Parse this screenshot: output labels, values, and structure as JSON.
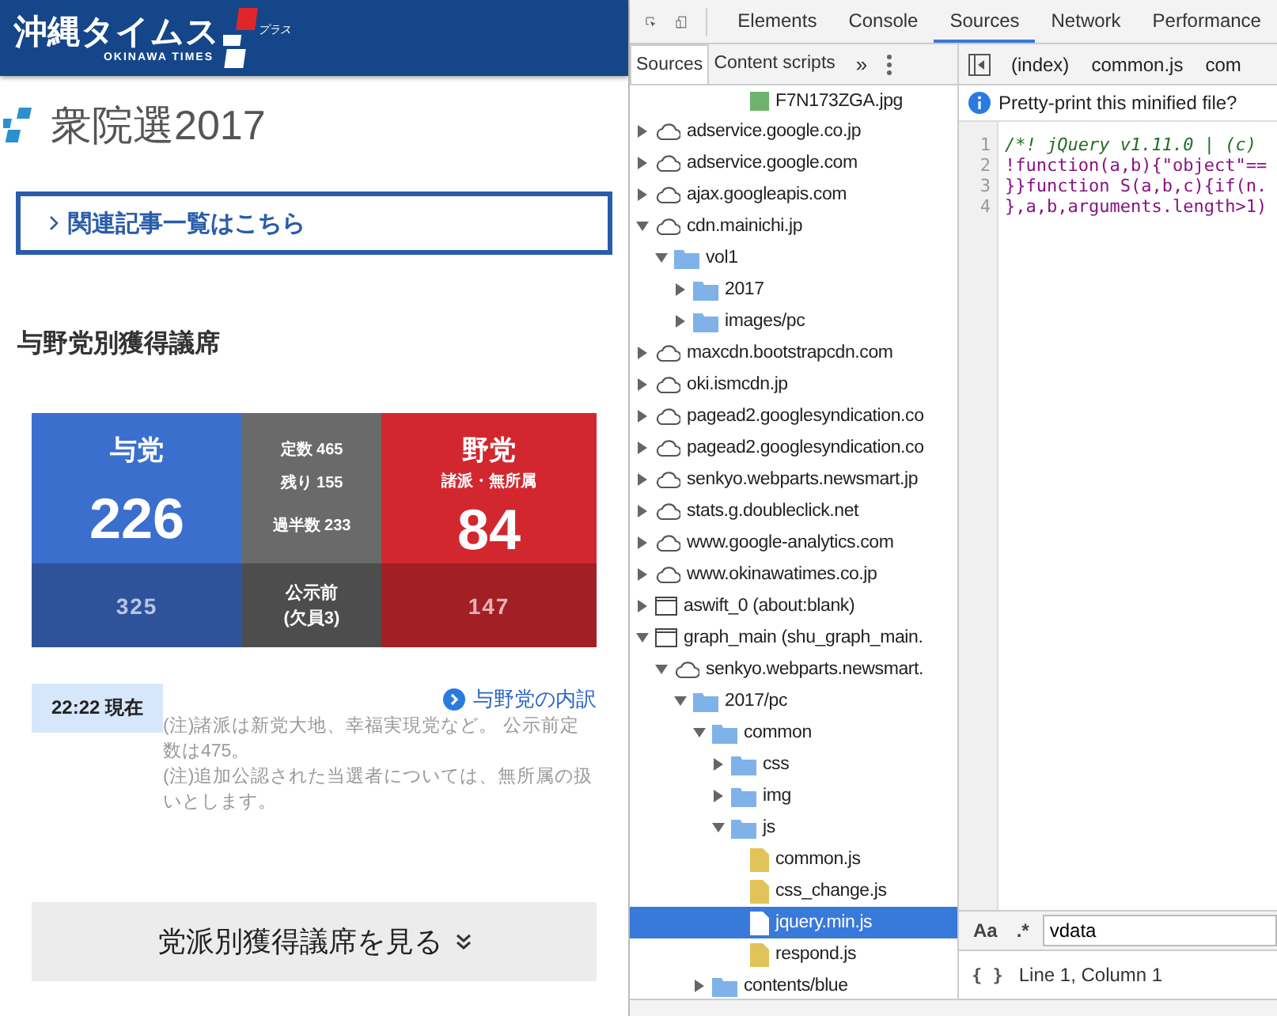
{
  "page": {
    "logo": {
      "name": "沖縄タイムス",
      "plus": "プラス",
      "romaji": "OKINAWA TIMES"
    },
    "title": "衆院選2017",
    "related_link": "関連記事一覧はこちら",
    "section_heading": "与野党別獲得議席",
    "scoreboard": {
      "columns": [
        {
          "kind": "ruling",
          "name": "与党",
          "seats": "226",
          "before": "325"
        },
        {
          "kind": "center",
          "lines": [
            "定数 465",
            "残り 155",
            "過半数 233"
          ],
          "before_lines": [
            "公示前",
            "(欠員3)"
          ]
        },
        {
          "kind": "opposition",
          "name": "野党",
          "sub": "諸派・無所属",
          "seats": "84",
          "before": "147"
        }
      ]
    },
    "timestamp": "22:22 現在",
    "breakdown_link": "与野党の内訳",
    "notes": [
      "(注)諸派は新党大地、幸福実現党など。 公示前定数は475。",
      "(注)追加公認された当選者については、無所属の扱いとします。"
    ],
    "more_button": "党派別獲得議席を見る"
  },
  "devtools": {
    "main_tabs": [
      {
        "label": "Elements",
        "selected": false
      },
      {
        "label": "Console",
        "selected": false
      },
      {
        "label": "Sources",
        "selected": true
      },
      {
        "label": "Network",
        "selected": false
      },
      {
        "label": "Performance",
        "selected": false
      }
    ],
    "navigator_tabs": [
      {
        "label": "Sources",
        "selected": true
      },
      {
        "label": "Content scripts",
        "selected": false
      }
    ],
    "more_tabs": "»",
    "partial_top_item": {
      "kind": "image",
      "name": "F7N173ZGA.jpg"
    },
    "tree": [
      {
        "kind": "domain",
        "name": "adservice.google.co.jp",
        "expanded": false
      },
      {
        "kind": "domain",
        "name": "adservice.google.com",
        "expanded": false
      },
      {
        "kind": "domain",
        "name": "ajax.googleapis.com",
        "expanded": false
      },
      {
        "kind": "domain",
        "name": "cdn.mainichi.jp",
        "expanded": true,
        "children": [
          {
            "kind": "folder",
            "name": "vol1",
            "expanded": true,
            "children": [
              {
                "kind": "folder",
                "name": "2017",
                "expanded": false
              },
              {
                "kind": "folder",
                "name": "images/pc",
                "expanded": false
              }
            ]
          }
        ]
      },
      {
        "kind": "domain",
        "name": "maxcdn.bootstrapcdn.com",
        "expanded": false
      },
      {
        "kind": "domain",
        "name": "oki.ismcdn.jp",
        "expanded": false
      },
      {
        "kind": "domain",
        "name": "pagead2.googlesyndication.co",
        "expanded": false
      },
      {
        "kind": "domain",
        "name": "pagead2.googlesyndication.co",
        "expanded": false
      },
      {
        "kind": "domain",
        "name": "senkyo.webparts.newsmart.jp",
        "expanded": false
      },
      {
        "kind": "domain",
        "name": "stats.g.doubleclick.net",
        "expanded": false
      },
      {
        "kind": "domain",
        "name": "www.google-analytics.com",
        "expanded": false
      },
      {
        "kind": "domain",
        "name": "www.okinawatimes.co.jp",
        "expanded": false
      },
      {
        "kind": "frame",
        "name": "aswift_0 (about:blank)",
        "expanded": false
      },
      {
        "kind": "frame",
        "name": "graph_main (shu_graph_main.",
        "expanded": true,
        "children": [
          {
            "kind": "domain",
            "name": "senkyo.webparts.newsmart.",
            "expanded": true,
            "children": [
              {
                "kind": "folder",
                "name": "2017/pc",
                "expanded": true,
                "children": [
                  {
                    "kind": "folder",
                    "name": "common",
                    "expanded": true,
                    "children": [
                      {
                        "kind": "folder",
                        "name": "css",
                        "expanded": false
                      },
                      {
                        "kind": "folder",
                        "name": "img",
                        "expanded": false
                      },
                      {
                        "kind": "folder",
                        "name": "js",
                        "expanded": true,
                        "children": [
                          {
                            "kind": "file",
                            "name": "common.js",
                            "selected": false
                          },
                          {
                            "kind": "file",
                            "name": "css_change.js",
                            "selected": false
                          },
                          {
                            "kind": "file",
                            "name": "jquery.min.js",
                            "selected": true
                          },
                          {
                            "kind": "file",
                            "name": "respond.js",
                            "selected": false
                          }
                        ]
                      }
                    ]
                  },
                  {
                    "kind": "folder",
                    "name": "contents/blue",
                    "expanded": false
                  }
                ]
              }
            ]
          }
        ]
      }
    ],
    "editor_tabs": [
      {
        "label": "(index)"
      },
      {
        "label": "common.js"
      },
      {
        "label": "com"
      }
    ],
    "infobar": "Pretty-print this minified file?",
    "code_lines": [
      {
        "number": "1",
        "kind": "comment",
        "text": "/*! jQuery v1.11.0 | (c) "
      },
      {
        "number": "2",
        "kind": "code",
        "text": "!function(a,b){\"object\"=="
      },
      {
        "number": "3",
        "kind": "code",
        "text": "}}function S(a,b,c){if(n."
      },
      {
        "number": "4",
        "kind": "code",
        "text": "},a,b,arguments.length>1)"
      }
    ],
    "search": {
      "case_toggle": "Aa",
      "regex_toggle": ".*",
      "value": "vdata"
    },
    "status": {
      "pretty_print": "{ }",
      "position": "Line 1, Column 1"
    }
  }
}
